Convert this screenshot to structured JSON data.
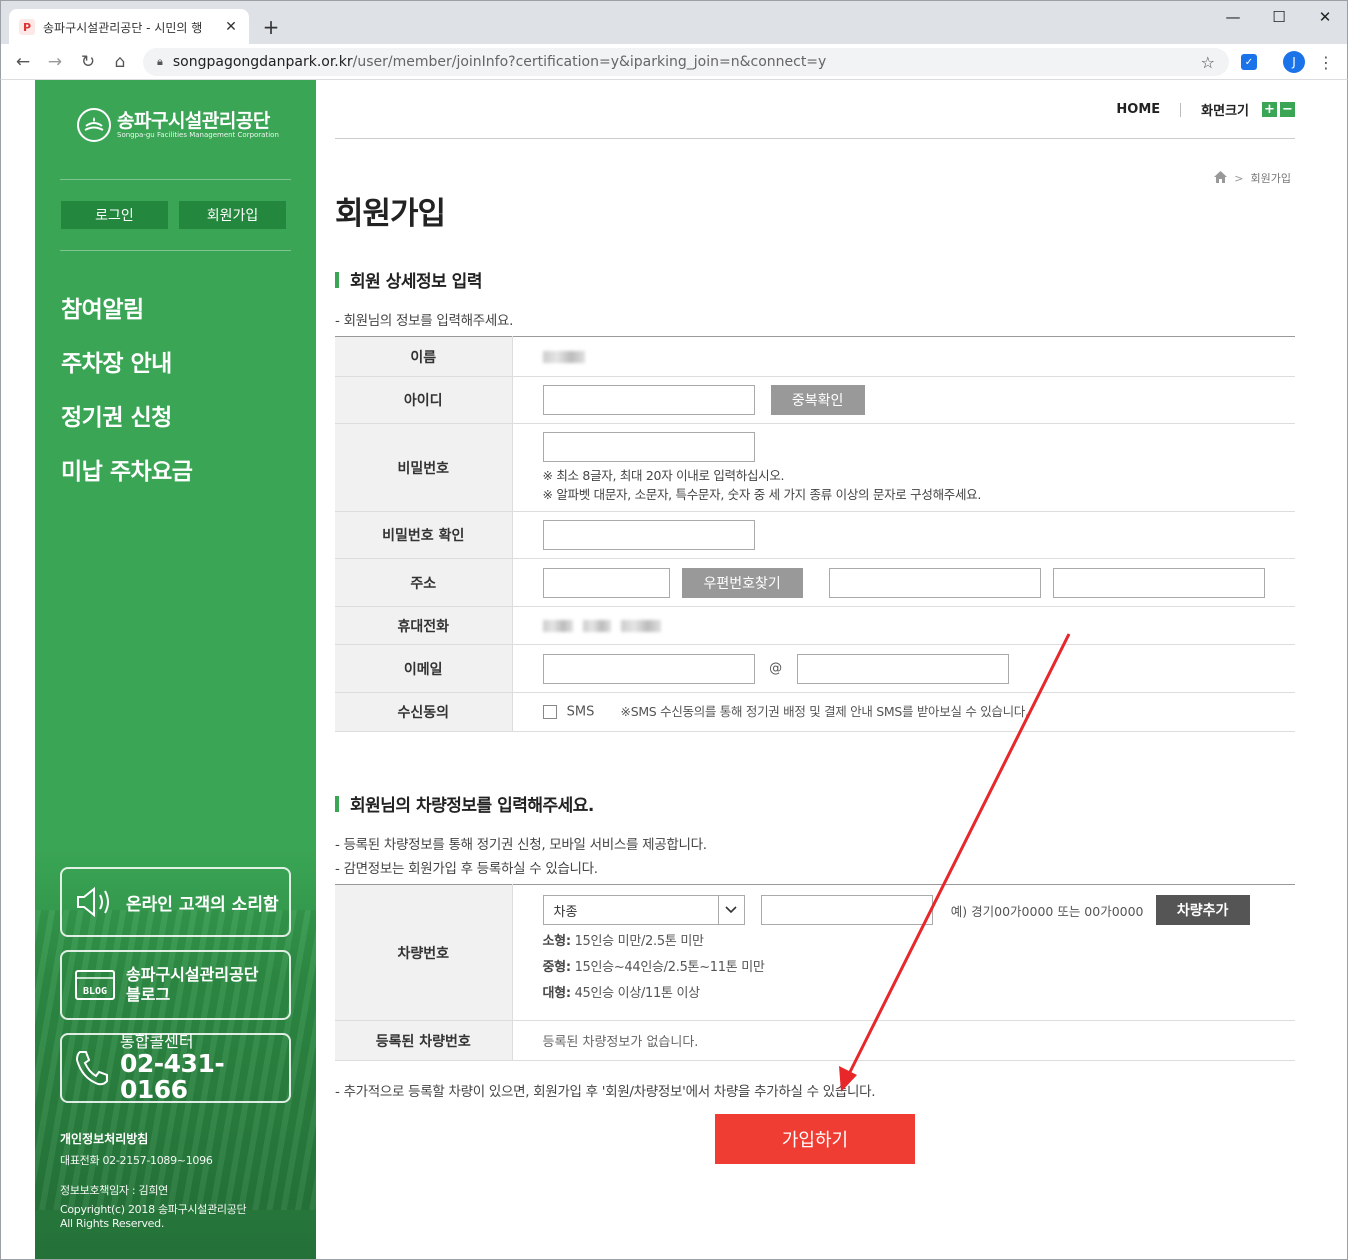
{
  "browser": {
    "tab_title": "송파구시설관리공단 - 시민의 행",
    "tab_favicon": "P",
    "url_host": "songpagongdanpark.or.kr",
    "url_path": "/user/member/joinInfo?certification=y&iparking_join=n&connect=y",
    "avatar_letter": "J"
  },
  "sidebar": {
    "logo_name": "송파구시설관리공단",
    "logo_sub": "Songpa-gu Facilities Management Corporation",
    "login_label": "로그인",
    "join_label": "회원가입",
    "menu": [
      "참여알림",
      "주차장 안내",
      "정기권 신청",
      "미납 주차요금"
    ],
    "box_voice": "온라인 고객의 소리함",
    "box_blog_line1": "송파구시설관리공단",
    "box_blog_line2": "블로그",
    "blog_icon_text": "BLOG",
    "box_call_label": "통합콜센터",
    "box_call_phone": "02-431-0166",
    "privacy_title": "개인정보처리방침",
    "rep_phone": "대표전화 02-2157-1089~1096",
    "privacy_officer": "정보보호책임자 : 김희연",
    "copyright_1": "Copyright(c) 2018 송파구시설관리공단",
    "copyright_2": "All Rights Reserved."
  },
  "header": {
    "home_label": "HOME",
    "zoom_label": "화면크기",
    "zoom_plus": "+",
    "zoom_minus": "−",
    "breadcrumb_current": "회원가입"
  },
  "page": {
    "title": "회원가입",
    "section1_title": "회원 상세정보 입력",
    "section1_desc": "- 회원님의 정보를 입력해주세요.",
    "section2_title": "회원님의 차량정보를 입력해주세요.",
    "section2_desc1": "- 등록된 차량정보를 통해 정기권 신청, 모바일 서비스를 제공합니다.",
    "section2_desc2": "- 감면정보는 회원가입 후 등록하실 수 있습니다.",
    "bottom_note": "- 추가적으로 등록할 차량이 있으면, 회원가입 후 '회원/차량정보'에서 차량을 추가하실 수 있습니다.",
    "join_button": "가입하기"
  },
  "form": {
    "name_label": "이름",
    "id_label": "아이디",
    "id_value": "",
    "dup_check": "중복확인",
    "pw_label": "비밀번호",
    "pw_note1": "※ 최소 8글자, 최대 20자 이내로 입력하십시오.",
    "pw_note2": "※ 알파벳 대문자, 소문자, 특수문자, 숫자 중 세 가지 종류 이상의 문자로 구성해주세요.",
    "pw_confirm_label": "비밀번호 확인",
    "addr_label": "주소",
    "zip_search": "우편번호찾기",
    "phone_label": "휴대전화",
    "email_label": "이메일",
    "email_at": "@",
    "consent_label": "수신동의",
    "sms_label": "SMS",
    "sms_note": "※SMS 수신동의를 통해 정기권 배정 및 결제 안내 SMS를 받아보실 수 있습니다."
  },
  "vehicle": {
    "car_no_label": "차량번호",
    "car_type_selected": "차종",
    "car_example": "예) 경기00가0000 또는 00가0000",
    "add_car": "차량추가",
    "small_label": "소형:",
    "small_desc": " 15인승 미만/2.5톤 미만",
    "mid_label": "중형:",
    "mid_desc": " 15인승~44인승/2.5톤~11톤 미만",
    "large_label": "대형:",
    "large_desc": " 45인승 이상/11톤 이상",
    "registered_label": "등록된 차량번호",
    "registered_value": "등록된 차량정보가 없습니다."
  },
  "colors": {
    "brand_green": "#3aa555",
    "join_red": "#ef3d33",
    "annotation_arrow": "#e8272a"
  }
}
